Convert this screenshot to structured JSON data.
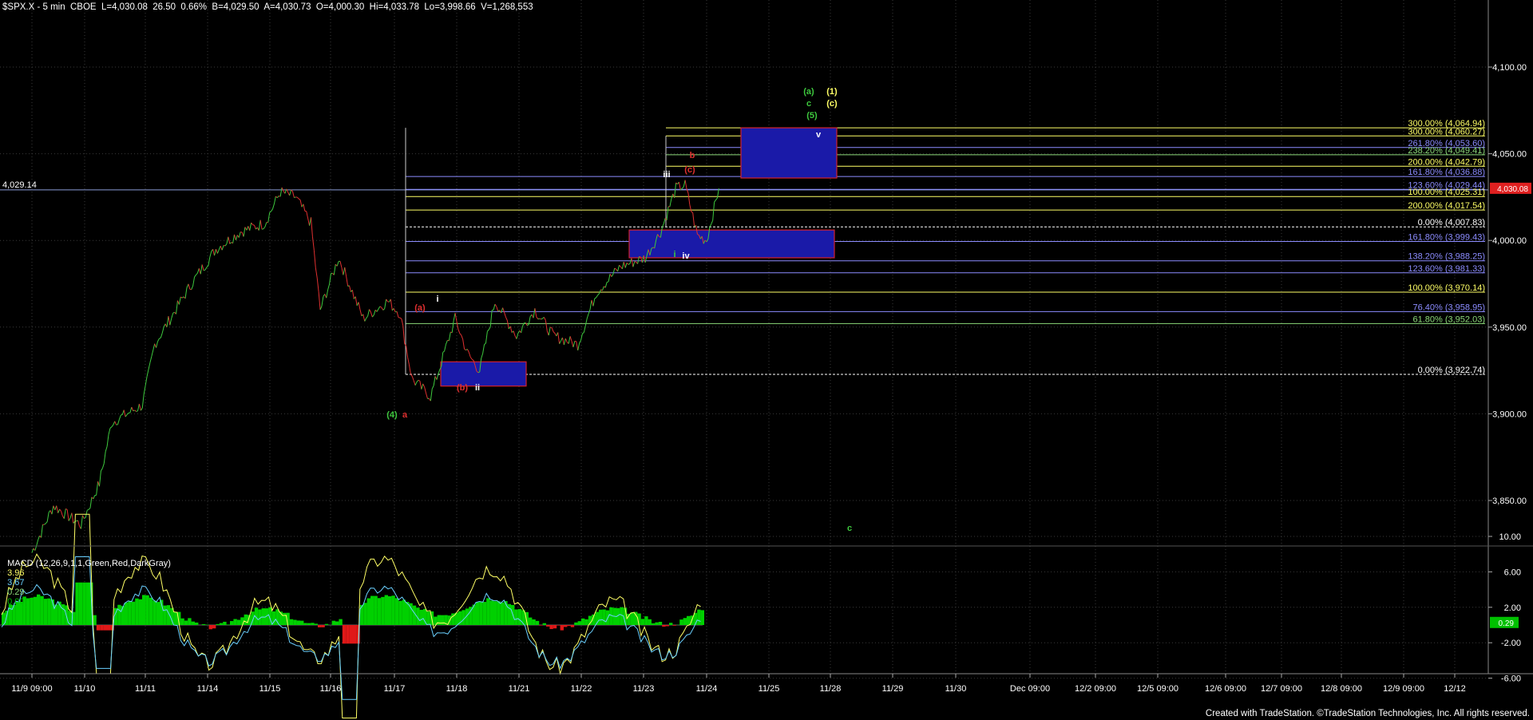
{
  "header": {
    "symbol_info": "$SPX.X - 5 min  CBOE  L=4,030.08  26.50  0.66%  B=4,029.50  A=4,030.73  O=4,000.30  Hi=4,033.78  Lo=3,998.66  V=1,268,553"
  },
  "left_level": "4,029.14",
  "price_axis": {
    "ticks": [
      "4,100.00",
      "4,050.00",
      "4,000.00",
      "3,950.00",
      "3,900.00",
      "3,850.00"
    ],
    "last_price_label": "4,030.08"
  },
  "macd": {
    "label": "MACD (12,26,9,1,1,Green,Red,DarkGray)",
    "values": [
      "3.96",
      "3.67",
      "0.29",
      "0.00"
    ],
    "axis_ticks": [
      "10.00",
      "6.00",
      "2.00",
      "-2.00",
      "-6.00"
    ],
    "current_label": "0.29"
  },
  "date_axis": [
    "11/9 09:00",
    "11/10",
    "11/11",
    "11/14",
    "11/15",
    "11/16",
    "11/17",
    "11/18",
    "11/21",
    "11/22",
    "11/23",
    "11/24",
    "11/25",
    "11/28",
    "11/29",
    "11/30",
    "Dec 09:00",
    "12/2 09:00",
    "12/5 09:00",
    "12/6 09:00",
    "12/7 09:00",
    "12/8 09:00",
    "12/9 09:00",
    "12/12"
  ],
  "fib_levels": [
    {
      "label": "300.00% (4,064.94)",
      "price": 4064.94,
      "color": "#ffff66"
    },
    {
      "label": "300.00% (4,060.27)",
      "price": 4060.27,
      "color": "#ffff66"
    },
    {
      "label": "261.80% (4,053.60)",
      "price": 4053.6,
      "color": "#8c8cff"
    },
    {
      "label": "238.20% (4,049.41)",
      "price": 4049.41,
      "color": "#8cd97a"
    },
    {
      "label": "200.00% (4,042.79)",
      "price": 4042.79,
      "color": "#ffff66"
    },
    {
      "label": "161.80% (4,036.88)",
      "price": 4036.88,
      "color": "#8c8cff"
    },
    {
      "label": "123.60% (4,029.44)",
      "price": 4029.44,
      "color": "#8c8cff"
    },
    {
      "label": "100.00% (4,025.31)",
      "price": 4025.31,
      "color": "#ffff66"
    },
    {
      "label": "200.00% (4,017.54)",
      "price": 4017.54,
      "color": "#ffff66"
    },
    {
      "label": "0.00% (4,007.83)",
      "price": 4007.83,
      "color": "#ffffff"
    },
    {
      "label": "161.80% (3,999.43)",
      "price": 3999.43,
      "color": "#8c8cff"
    },
    {
      "label": "138.20% (3,988.25)",
      "price": 3988.25,
      "color": "#8c8cff"
    },
    {
      "label": "123.60% (3,981.33)",
      "price": 3981.33,
      "color": "#8c8cff"
    },
    {
      "label": "100.00% (3,970.14)",
      "price": 3970.14,
      "color": "#ffff66"
    },
    {
      "label": "76.40% (3,958.95)",
      "price": 3958.95,
      "color": "#8c8cff"
    },
    {
      "label": "61.80% (3,952.03)",
      "price": 3952.03,
      "color": "#8cd97a"
    },
    {
      "label": "0.00% (3,922.74)",
      "price": 3922.74,
      "color": "#ffffff"
    }
  ],
  "wave_labels": {
    "a_green": "(a)",
    "c_green": "c",
    "five_green": "(5)",
    "one_yellow": "(1)",
    "c_yellow": "(c)",
    "v_white": "v",
    "b_red": "b",
    "c_red": "(c)",
    "iii_white": "iii",
    "i_green": "i",
    "iv_white": "iv",
    "a_red": "(a)",
    "i_white": "i",
    "b_red_paren": "(b)",
    "ii_white": "ii",
    "four_green": "(4)",
    "a_red_small": "a",
    "c_green_low": "c"
  },
  "footer": "Created with TradeStation. ©TradeStation Technologies, Inc. All rights reserved.",
  "chart_data": {
    "type": "line",
    "title": "$SPX.X - 5 min",
    "ylim": [
      3817,
      4110
    ],
    "price_path": {
      "x": [
        "11/9 09:00",
        "11/10",
        "11/11",
        "11/14",
        "11/15",
        "11/16",
        "11/17",
        "11/18",
        "11/21",
        "11/22",
        "11/23",
        "11/24"
      ],
      "anchors": [
        [
          0,
          3820
        ],
        [
          0.35,
          3847
        ],
        [
          0.8,
          3836
        ],
        [
          1.1,
          3860
        ],
        [
          1.3,
          3895
        ],
        [
          1.8,
          3905
        ],
        [
          2.0,
          3940
        ],
        [
          2.6,
          3975
        ],
        [
          3.0,
          3995
        ],
        [
          3.4,
          4005
        ],
        [
          3.8,
          4010
        ],
        [
          4.05,
          4028
        ],
        [
          4.3,
          4025
        ],
        [
          4.55,
          4010
        ],
        [
          4.7,
          3960
        ],
        [
          5.0,
          3990
        ],
        [
          5.4,
          3955
        ],
        [
          5.8,
          3965
        ],
        [
          6.0,
          3958
        ],
        [
          6.2,
          3920
        ],
        [
          6.5,
          3910
        ],
        [
          6.9,
          3955
        ],
        [
          7.1,
          3935
        ],
        [
          7.3,
          3925
        ],
        [
          7.55,
          3965
        ],
        [
          7.9,
          3945
        ],
        [
          8.2,
          3960
        ],
        [
          8.5,
          3945
        ],
        [
          8.9,
          3940
        ],
        [
          9.2,
          3970
        ],
        [
          9.6,
          3985
        ],
        [
          10.0,
          3990
        ],
        [
          10.25,
          4005
        ],
        [
          10.5,
          4030
        ],
        [
          10.65,
          4032
        ],
        [
          10.85,
          4003
        ],
        [
          11.0,
          4000
        ],
        [
          11.2,
          4030
        ]
      ]
    },
    "macd": {
      "type": "line",
      "series": [
        {
          "values": [
            3.96
          ]
        },
        {
          "values": [
            3.67
          ]
        },
        {
          "values": [
            0.29
          ]
        }
      ]
    }
  }
}
